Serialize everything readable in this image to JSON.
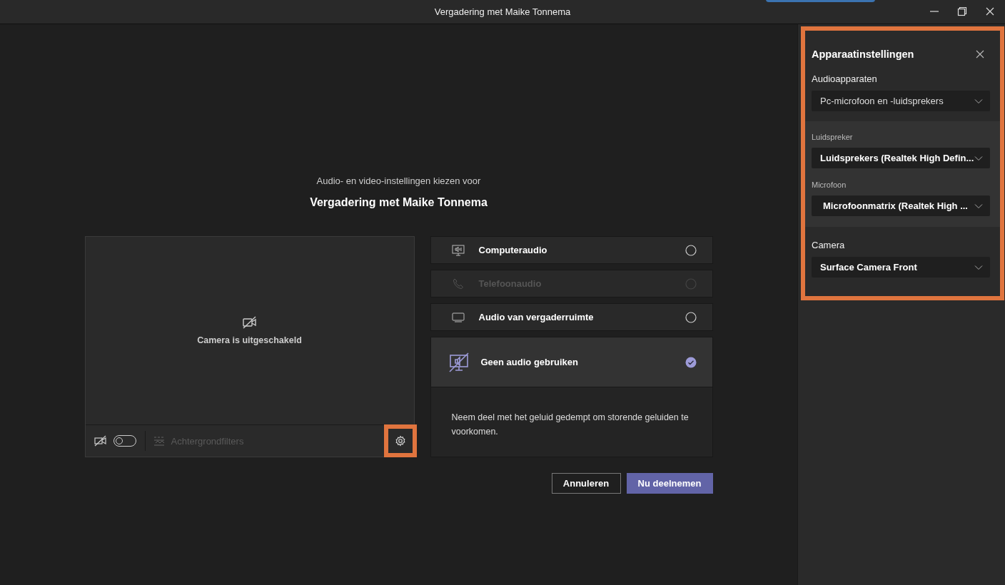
{
  "title_bar": {
    "title": "Vergadering met Maike Tonnema"
  },
  "prejoin": {
    "subtitle": "Audio- en video-instellingen kiezen voor",
    "meeting_title": "Vergadering met Maike Tonnema"
  },
  "preview": {
    "camera_status": "Camera is uitgeschakeld",
    "camera_on": false,
    "background_filters": {
      "label": "Achtergrondfilters",
      "disabled": true
    },
    "settings_highlighted": true
  },
  "audio_options": [
    {
      "kind": "computer",
      "label": "Computeraudio",
      "selected": false,
      "disabled": false
    },
    {
      "kind": "phone",
      "label": "Telefoonaudio",
      "selected": false,
      "disabled": true
    },
    {
      "kind": "room",
      "label": "Audio van vergaderruimte",
      "selected": false,
      "disabled": false
    },
    {
      "kind": "none",
      "label": "Geen audio gebruiken",
      "selected": true,
      "disabled": false
    }
  ],
  "selected_description": "Neem deel met het geluid gedempt om storende geluiden te voorkomen.",
  "buttons": [
    {
      "kind": "cancel",
      "label": "Annuleren"
    },
    {
      "kind": "primary",
      "label": "Nu deelnemen"
    }
  ],
  "device_settings": {
    "title": "Apparaatinstellingen",
    "highlighted": true,
    "audio_devices": {
      "label": "Audioapparaten",
      "value": "Pc-microfoon en -luidsprekers"
    },
    "speaker": {
      "label": "Luidspreker",
      "value": "Luidsprekers (Realtek High Defin..."
    },
    "microphone": {
      "label": "Microfoon",
      "value": "Microfoonmatrix (Realtek High ..."
    },
    "camera": {
      "label": "Camera",
      "value": "Surface Camera Front"
    }
  }
}
